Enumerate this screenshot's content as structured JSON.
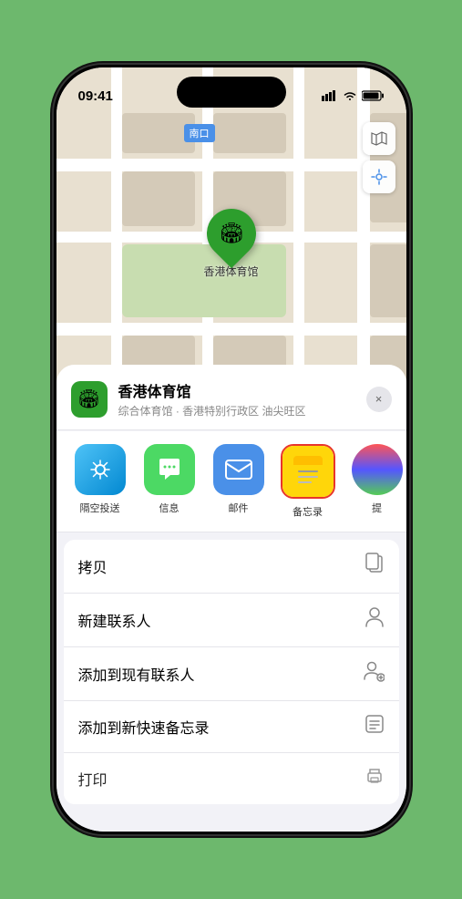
{
  "status_bar": {
    "time": "09:41",
    "signal_icon": "▌▌▌",
    "wifi_icon": "wifi",
    "battery_icon": "battery"
  },
  "map": {
    "north_label": "南口",
    "venue_pin_label": "香港体育馆",
    "controls": {
      "map_type_icon": "map",
      "location_icon": "location"
    }
  },
  "sheet": {
    "venue_icon": "🏟",
    "venue_name": "香港体育馆",
    "venue_desc": "综合体育馆 · 香港特别行政区 油尖旺区",
    "close_label": "×",
    "share_items": [
      {
        "label": "隔空投送",
        "type": "airdrop"
      },
      {
        "label": "信息",
        "type": "message"
      },
      {
        "label": "邮件",
        "type": "mail"
      },
      {
        "label": "备忘录",
        "type": "notes",
        "selected": true
      },
      {
        "label": "提",
        "type": "more"
      }
    ],
    "actions": [
      {
        "label": "拷贝",
        "icon": "copy"
      },
      {
        "label": "新建联系人",
        "icon": "person"
      },
      {
        "label": "添加到现有联系人",
        "icon": "person-add"
      },
      {
        "label": "添加到新快速备忘录",
        "icon": "note"
      },
      {
        "label": "打印",
        "icon": "print"
      }
    ]
  }
}
